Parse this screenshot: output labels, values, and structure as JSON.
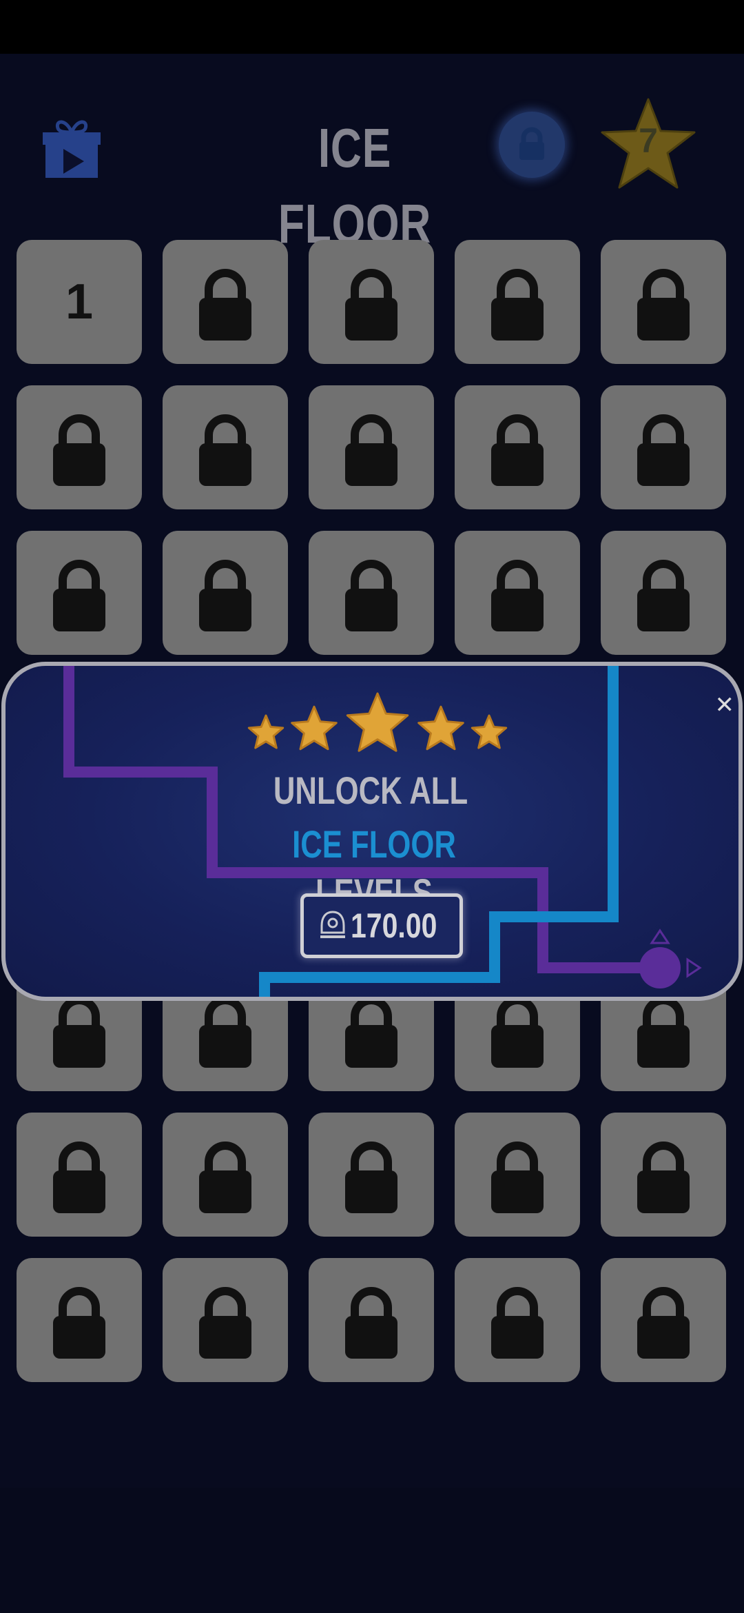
{
  "header": {
    "title": "ICE FLOOR",
    "stars_count": "7",
    "gift_icon": "gift-video-icon",
    "lock_icon": "lock-icon"
  },
  "levels": [
    {
      "label": "1",
      "locked": false
    },
    {
      "label": "",
      "locked": true
    },
    {
      "label": "",
      "locked": true
    },
    {
      "label": "",
      "locked": true
    },
    {
      "label": "",
      "locked": true
    },
    {
      "label": "",
      "locked": true
    },
    {
      "label": "",
      "locked": true
    },
    {
      "label": "",
      "locked": true
    },
    {
      "label": "",
      "locked": true
    },
    {
      "label": "",
      "locked": true
    },
    {
      "label": "",
      "locked": true
    },
    {
      "label": "",
      "locked": true
    },
    {
      "label": "",
      "locked": true
    },
    {
      "label": "",
      "locked": true
    },
    {
      "label": "",
      "locked": true
    },
    {
      "label": "",
      "locked": true
    },
    {
      "label": "",
      "locked": true
    },
    {
      "label": "",
      "locked": true
    },
    {
      "label": "",
      "locked": true
    },
    {
      "label": "",
      "locked": true
    },
    {
      "label": "",
      "locked": true
    },
    {
      "label": "",
      "locked": true
    },
    {
      "label": "",
      "locked": true
    },
    {
      "label": "",
      "locked": true
    },
    {
      "label": "",
      "locked": true
    },
    {
      "label": "",
      "locked": true
    },
    {
      "label": "",
      "locked": true
    },
    {
      "label": "",
      "locked": true
    },
    {
      "label": "",
      "locked": true
    },
    {
      "label": "",
      "locked": true
    },
    {
      "label": "",
      "locked": true
    },
    {
      "label": "",
      "locked": true
    },
    {
      "label": "",
      "locked": true
    },
    {
      "label": "",
      "locked": true
    },
    {
      "label": "",
      "locked": true
    },
    {
      "label": "",
      "locked": true
    },
    {
      "label": "",
      "locked": true
    },
    {
      "label": "",
      "locked": true
    },
    {
      "label": "",
      "locked": true
    },
    {
      "label": "",
      "locked": true
    }
  ],
  "popup": {
    "line1": "UNLOCK ALL",
    "line2_accent": "ICE FLOOR",
    "line2_rest": "LEVELS",
    "price": "170.00",
    "currency_icon": "currency-icon",
    "close_icon": "close-icon",
    "stars": 5
  },
  "colors": {
    "accent_blue": "#1b8fd1",
    "accent_purple": "#5a2d99",
    "star_gold": "#e0a437",
    "tile_gray": "#717171"
  }
}
